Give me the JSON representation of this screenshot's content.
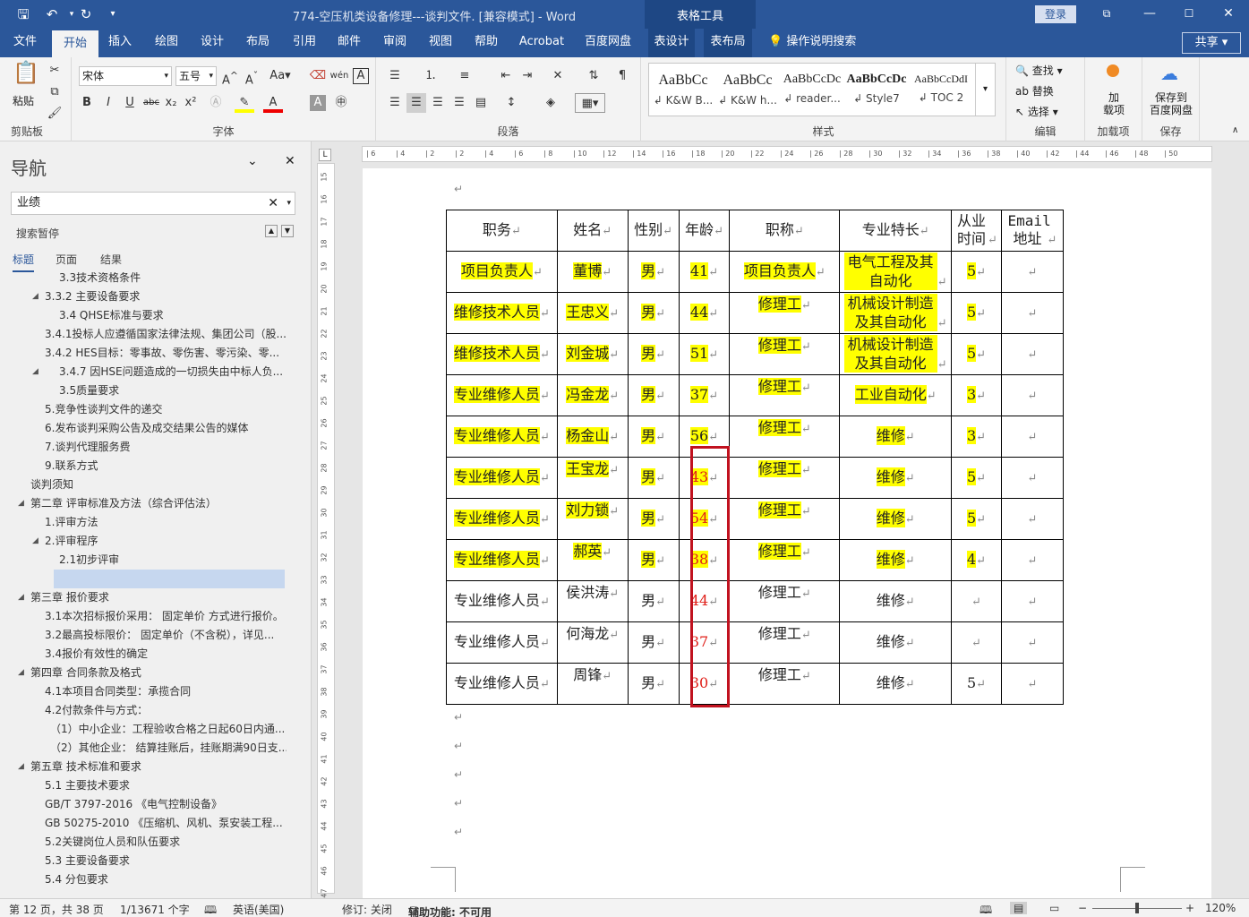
{
  "title": "774-空压机类设备修理---谈判文件. [兼容模式] - Word",
  "tabletools": "表格工具",
  "login": "登录",
  "tabs": [
    "文件",
    "开始",
    "插入",
    "绘图",
    "设计",
    "布局",
    "引用",
    "邮件",
    "审阅",
    "视图",
    "帮助",
    "Acrobat",
    "百度网盘",
    "表设计",
    "表布局"
  ],
  "tellme": "操作说明搜索",
  "share": "共享",
  "ribbon": {
    "paste": "粘贴",
    "clipboard": "剪贴板",
    "font_name": "宋体",
    "font_size": "五号",
    "font_group": "字体",
    "para_group": "段落",
    "styles_group": "样式",
    "find": "查找",
    "replace": "替换",
    "select": "选择",
    "edit_group": "编辑",
    "addin": "加\n载项",
    "addin_group": "加载项",
    "save_baidu": "保存到\n百度网盘",
    "save_group": "保存",
    "styles": [
      {
        "preview": "AaBbCc",
        "name": "↲ K&W B..."
      },
      {
        "preview": "AaBbCc",
        "name": "↲ K&W h..."
      },
      {
        "preview": "AaBbCcDc",
        "name": "↲ reader..."
      },
      {
        "preview": "AaBbCcDc",
        "name": "↲ Style7"
      },
      {
        "preview": "AaBbCcDdI",
        "name": "↲ TOC 2"
      }
    ]
  },
  "nav": {
    "title": "导航",
    "search": "业绩",
    "paused": "搜索暂停",
    "tabs": [
      "标题",
      "页面",
      "结果"
    ],
    "items": [
      "3.3技术资格条件",
      "3.3.2 主要设备要求",
      "3.4 QHSE标准与要求",
      "3.4.1投标人应遵循国家法律法规、集团公司（股...",
      "3.4.2 HES目标：零事故、零伤害、零污染、零...",
      "3.4.7 因HSE问题造成的一切损失由中标人负...",
      "3.5质量要求",
      "5.竞争性谈判文件的递交",
      "6.发布谈判采购公告及成交结果公告的媒体",
      "7.谈判代理服务费",
      "9.联系方式",
      "谈判须知",
      "第二章 评审标准及方法（综合评估法）",
      "1.评审方法",
      "2.评审程序",
      "2.1初步评审",
      "",
      "第三章 报价要求",
      "3.1本次招标报价采用： 固定单价 方式进行报价。",
      "3.2最高投标限价： 固定单价（不含税），详见...",
      "3.4报价有效性的确定",
      "第四章 合同条款及格式",
      "4.1本项目合同类型：承揽合同",
      "4.2付款条件与方式：",
      "（1）中小企业：工程验收合格之日起60日内通...",
      "（2）其他企业： 结算挂账后，挂账期满90日支...",
      "第五章 技术标准和要求",
      "5.1 主要技术要求",
      "GB/T 3797-2016 《电气控制设备》",
      "GB 50275-2010 《压缩机、风机、泵安装工程...",
      "5.2关键岗位人员和队伍要求",
      "5.3 主要设备要求",
      "5.4 分包要求"
    ]
  },
  "table": {
    "headers": [
      "职务",
      "姓名",
      "性别",
      "年龄",
      "职称",
      "专业特长",
      "从业时间",
      "Email地址"
    ],
    "rows": [
      [
        "项目负责人",
        "董博",
        "男",
        "41",
        "项目负责人",
        "电气工程及其自动化",
        "5",
        ""
      ],
      [
        "维修技术人员",
        "王忠义",
        "男",
        "44",
        "修理工",
        "机械设计制造及其自动化",
        "5",
        ""
      ],
      [
        "维修技术人员",
        "刘金城",
        "男",
        "51",
        "修理工",
        "机械设计制造及其自动化",
        "5",
        ""
      ],
      [
        "专业维修人员",
        "冯金龙",
        "男",
        "37",
        "修理工",
        "工业自动化",
        "3",
        ""
      ],
      [
        "专业维修人员",
        "杨金山",
        "男",
        "56",
        "修理工",
        "维修",
        "3",
        ""
      ],
      [
        "专业维修人员",
        "王宝龙",
        "男",
        "43",
        "修理工",
        "维修",
        "5",
        ""
      ],
      [
        "专业维修人员",
        "刘力锁",
        "男",
        "54",
        "修理工",
        "维修",
        "5",
        ""
      ],
      [
        "专业维修人员",
        "郝英",
        "男",
        "38",
        "修理工",
        "维修",
        "4",
        ""
      ],
      [
        "专业维修人员",
        "侯洪涛",
        "男",
        "44",
        "修理工",
        "维修",
        "",
        ""
      ],
      [
        "专业维修人员",
        "何海龙",
        "男",
        "37",
        "修理工",
        "维修",
        "",
        ""
      ],
      [
        "专业维修人员",
        "周锋",
        "男",
        "30",
        "修理工",
        "维修",
        "5",
        ""
      ]
    ]
  },
  "status": {
    "page": "第 12 页，共 38 页",
    "words": "1/13671 个字",
    "lang": "英语(美国)",
    "track": "修订: 关闭",
    "access": "辅助功能: 不可用",
    "zoom": "120%"
  }
}
